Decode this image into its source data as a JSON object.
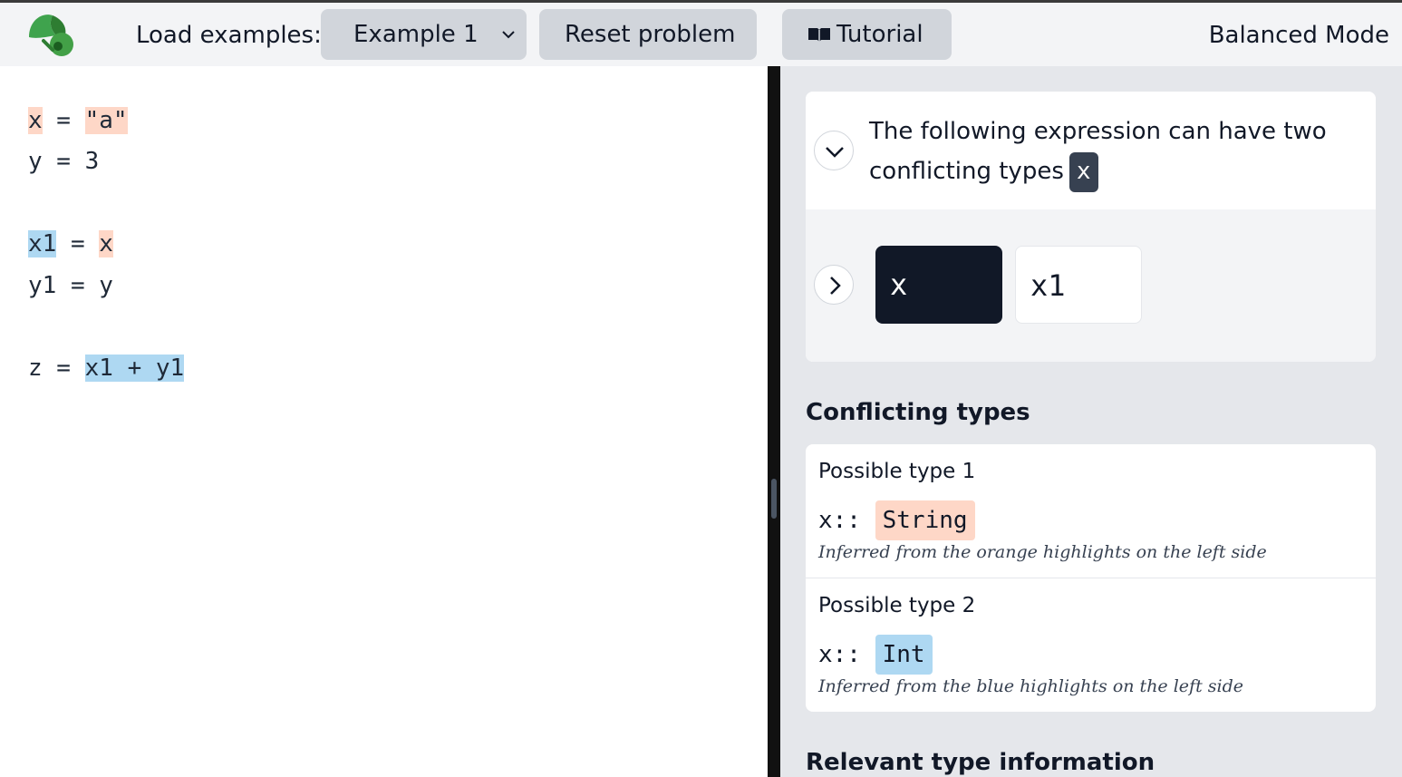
{
  "colors": {
    "orange_highlight": "#fed7c7",
    "blue_highlight": "#aed8f2",
    "dark": "#111827"
  },
  "toolbar": {
    "logo_icon": "leaf-logo-icon",
    "load_label": "Load examples:",
    "example_select": {
      "selected": "Example 1"
    },
    "reset_label": "Reset problem",
    "tutorial_icon": "book-icon",
    "tutorial_label": "Tutorial",
    "mode_label": "Balanced Mode"
  },
  "editor": {
    "lines": [
      {
        "lhs": "x",
        "op": " = ",
        "rhs": "\"a\""
      },
      {
        "lhs": "y",
        "op": " = ",
        "rhs": "3"
      },
      {
        "lhs": "x1",
        "op": " = ",
        "rhs": "x"
      },
      {
        "lhs": "y1",
        "op": " = ",
        "rhs": "y"
      },
      {
        "lhs": "z",
        "op": " = ",
        "rhs": "x1 + y1"
      }
    ]
  },
  "panel": {
    "conflict_card": {
      "message": "The following expression can have two conflicting types",
      "expression": "x",
      "steps": [
        "x",
        "x1"
      ]
    },
    "conflicting_title": "Conflicting types",
    "types": [
      {
        "title": "Possible type 1",
        "var": "x::",
        "type": "String",
        "note": "Inferred from the orange highlights on the left side"
      },
      {
        "title": "Possible type 2",
        "var": "x::",
        "type": "Int",
        "note": "Inferred from the blue highlights on the left side"
      }
    ],
    "relevant_title": "Relevant type information"
  }
}
